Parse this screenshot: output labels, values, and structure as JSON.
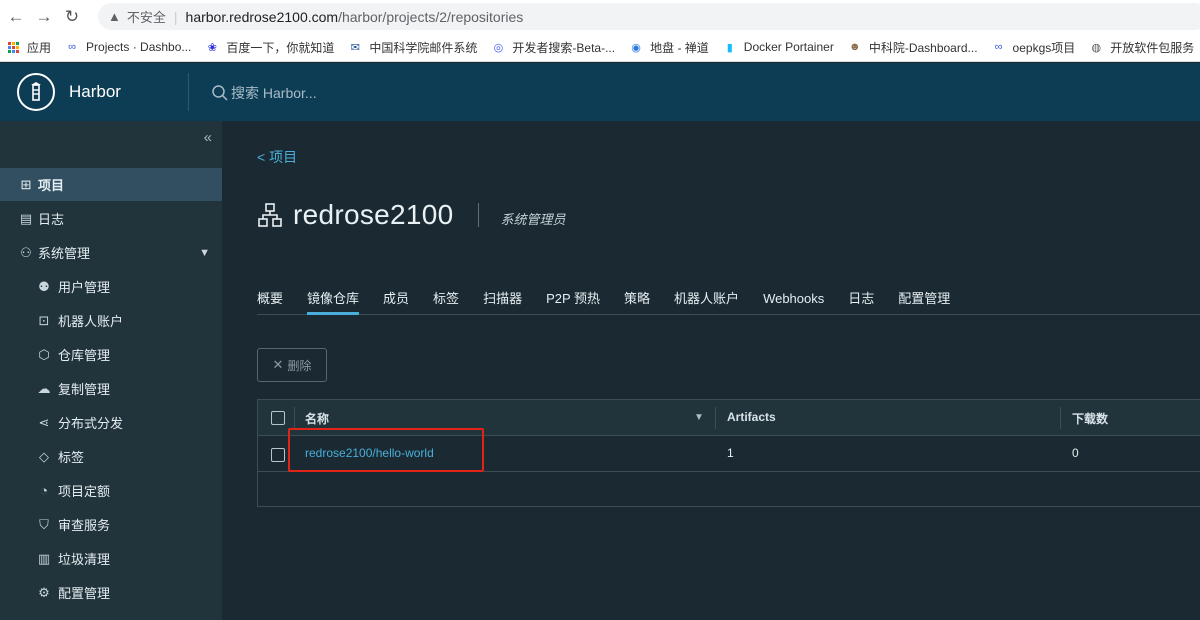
{
  "browser": {
    "insecure_label": "不安全",
    "url_host": "harbor.redrose2100.com",
    "url_path": "/harbor/projects/2/repositories"
  },
  "bookmarks": [
    {
      "label": "应用",
      "icon": "apps-icon"
    },
    {
      "label": "Projects · Dashbo...",
      "icon": "link-icon"
    },
    {
      "label": "百度一下，你就知道",
      "icon": "baidu-icon"
    },
    {
      "label": "中国科学院邮件系统",
      "icon": "mail-icon"
    },
    {
      "label": "开发者搜索-Beta-...",
      "icon": "search-icon"
    },
    {
      "label": "地盘 - 禅道",
      "icon": "zentao-icon"
    },
    {
      "label": "Docker Portainer",
      "icon": "portainer-icon"
    },
    {
      "label": "中科院-Dashboard...",
      "icon": "avatar-icon"
    },
    {
      "label": "oepkgs项目",
      "icon": "link-icon"
    },
    {
      "label": "开放软件包服务",
      "icon": "globe-icon"
    }
  ],
  "header": {
    "brand": "Harbor",
    "search_placeholder": "搜索 Harbor..."
  },
  "sidebar": {
    "items": [
      {
        "label": "项目",
        "icon": "project-icon"
      },
      {
        "label": "日志",
        "icon": "log-icon"
      },
      {
        "label": "系统管理",
        "icon": "admin-icon"
      },
      {
        "label": "用户管理",
        "icon": "users-icon"
      },
      {
        "label": "机器人账户",
        "icon": "robot-icon"
      },
      {
        "label": "仓库管理",
        "icon": "registry-icon"
      },
      {
        "label": "复制管理",
        "icon": "replication-icon"
      },
      {
        "label": "分布式分发",
        "icon": "share-icon"
      },
      {
        "label": "标签",
        "icon": "tag-icon"
      },
      {
        "label": "项目定额",
        "icon": "quota-icon"
      },
      {
        "label": "审查服务",
        "icon": "shield-icon"
      },
      {
        "label": "垃圾清理",
        "icon": "trash-icon"
      },
      {
        "label": "配置管理",
        "icon": "gear-icon"
      }
    ]
  },
  "main": {
    "back_label": "< 项目",
    "project_name": "redrose2100",
    "role": "系统管理员",
    "tabs": [
      "概要",
      "镜像仓库",
      "成员",
      "标签",
      "扫描器",
      "P2P 预热",
      "策略",
      "机器人账户",
      "Webhooks",
      "日志",
      "配置管理"
    ],
    "active_tab": "镜像仓库",
    "delete_label": "删除",
    "columns": [
      "名称",
      "Artifacts",
      "下载数"
    ],
    "rows": [
      {
        "name": "redrose2100/hello-world",
        "artifacts": "1",
        "pulls": "0"
      }
    ]
  },
  "colors": {
    "header_bg": "#0d3d54",
    "sidebar_bg": "#21333b",
    "content_bg": "#1b2a32",
    "accent": "#49aeda",
    "annotation_red": "#e2231a"
  }
}
